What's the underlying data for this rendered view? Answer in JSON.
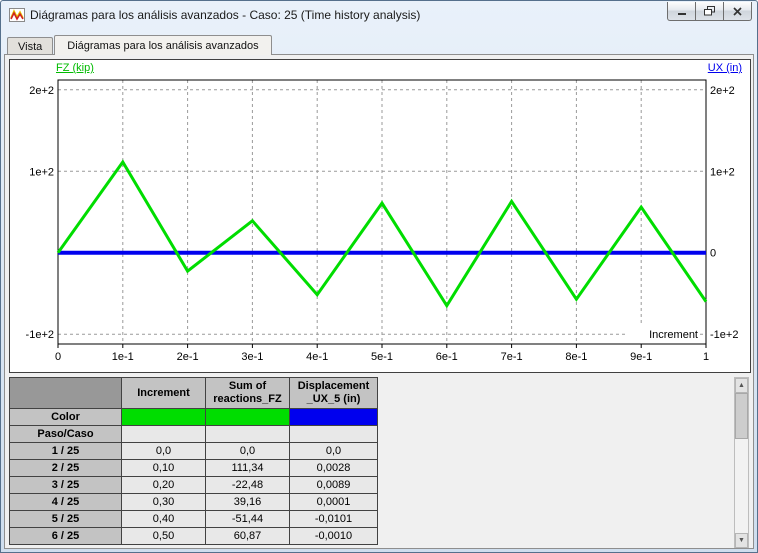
{
  "window": {
    "title": "Diágramas para los análisis avanzados - Caso: 25 (Time history analysis)",
    "controls": [
      "minimize",
      "restore",
      "close"
    ]
  },
  "tabs": [
    {
      "label": "Vista",
      "active": false
    },
    {
      "label": "Diágramas para los análisis avanzados",
      "active": true
    }
  ],
  "chart_data": {
    "type": "line",
    "xlim": [
      0,
      1
    ],
    "ylim": [
      -112,
      212
    ],
    "grid": true,
    "xlabel": "Increment",
    "left_axis": {
      "title": "FZ (kip)",
      "color": "#00cc00"
    },
    "right_axis": {
      "title": "UX (in)",
      "color": "#0000ee"
    },
    "x_ticks": [
      {
        "v": 0.0,
        "label": "0"
      },
      {
        "v": 0.1,
        "label": "1e-1"
      },
      {
        "v": 0.2,
        "label": "2e-1"
      },
      {
        "v": 0.3,
        "label": "3e-1"
      },
      {
        "v": 0.4,
        "label": "4e-1"
      },
      {
        "v": 0.5,
        "label": "5e-1"
      },
      {
        "v": 0.6,
        "label": "6e-1"
      },
      {
        "v": 0.7,
        "label": "7e-1"
      },
      {
        "v": 0.8,
        "label": "8e-1"
      },
      {
        "v": 0.9,
        "label": "9e-1"
      },
      {
        "v": 1.0,
        "label": "1"
      }
    ],
    "left_ticks": [
      {
        "v": 200,
        "label": "2e+2"
      },
      {
        "v": 100,
        "label": "1e+2"
      },
      {
        "v": -100,
        "label": "-1e+2"
      }
    ],
    "right_ticks": [
      {
        "v": 200,
        "label": "2e+2"
      },
      {
        "v": 100,
        "label": "1e+2"
      },
      {
        "v": 0,
        "label": "0"
      },
      {
        "v": -100,
        "label": "-1e+2"
      }
    ],
    "y_grid": [
      200,
      100,
      0,
      -100
    ],
    "series": [
      {
        "name": "Displacement _UX_5 (in)",
        "color": "#0000ee",
        "width": 4,
        "x": [
          0,
          0.1,
          0.2,
          0.3,
          0.4,
          0.5,
          0.6,
          0.7,
          0.8,
          0.9,
          1
        ],
        "values": [
          0,
          0.0028,
          0.0089,
          0.0001,
          -0.0101,
          -0.001,
          0,
          0,
          0,
          0,
          0
        ]
      },
      {
        "name": "Sum of reactions_FZ (kip)",
        "color": "#00dd00",
        "width": 3,
        "x": [
          0,
          0.1,
          0.2,
          0.3,
          0.4,
          0.5,
          0.6,
          0.7,
          0.8,
          0.9,
          1
        ],
        "values": [
          0,
          111.34,
          -22.48,
          39.16,
          -51.44,
          60.87,
          -65,
          63,
          -57,
          56,
          -60
        ]
      }
    ]
  },
  "table": {
    "headers": [
      "",
      "Increment",
      "Sum of\nreactions_FZ",
      "Displacement\n_UX_5 (in)"
    ],
    "color_row": {
      "label": "Color",
      "colors": [
        "#00dd00",
        "#00dd00",
        "#0000ee"
      ]
    },
    "paso_row": {
      "label": "Paso/Caso"
    },
    "rows": [
      {
        "label": "1 / 25",
        "values": [
          "0,0",
          "0,0",
          "0,0"
        ]
      },
      {
        "label": "2 / 25",
        "values": [
          "0,10",
          "111,34",
          "0,0028"
        ]
      },
      {
        "label": "3 / 25",
        "values": [
          "0,20",
          "-22,48",
          "0,0089"
        ]
      },
      {
        "label": "4 / 25",
        "values": [
          "0,30",
          "39,16",
          "0,0001"
        ]
      },
      {
        "label": "5 / 25",
        "values": [
          "0,40",
          "-51,44",
          "-0,0101"
        ]
      },
      {
        "label": "6 / 25",
        "values": [
          "0,50",
          "60,87",
          "-0,0010"
        ]
      }
    ]
  }
}
